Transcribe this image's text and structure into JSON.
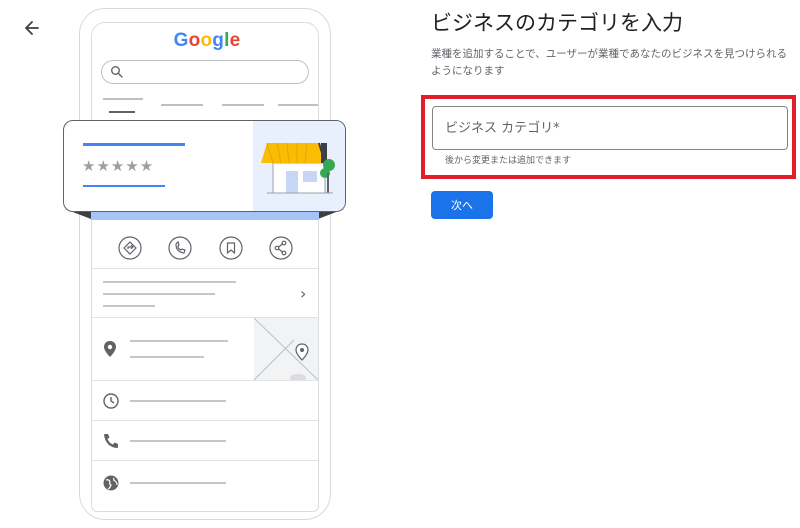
{
  "illustration": {
    "logo_text": "Google",
    "logo_colors": [
      "#4285f4",
      "#ea4335",
      "#fbbc05",
      "#4285f4",
      "#34a853",
      "#ea4335"
    ],
    "rating_stars": "★★★★★",
    "action_icons": [
      "directions-icon",
      "phone-icon",
      "bookmark-icon",
      "share-icon"
    ],
    "info_icons": [
      "location-pin-icon",
      "clock-icon",
      "phone-icon",
      "globe-icon"
    ],
    "chevron": "›"
  },
  "form": {
    "title": "ビジネスのカテゴリを入力",
    "description": "業種を追加することで、ユーザーが業種であなたのビジネスを見つけられるようになります",
    "category_placeholder": "ビジネス カテゴリ*",
    "category_value": "",
    "helper": "後から変更または追加できます",
    "next_label": "次へ"
  },
  "colors": {
    "accent": "#1a73e8",
    "highlight": "#e21d2c",
    "awning": "#fbbc04",
    "tree": "#34a853"
  }
}
